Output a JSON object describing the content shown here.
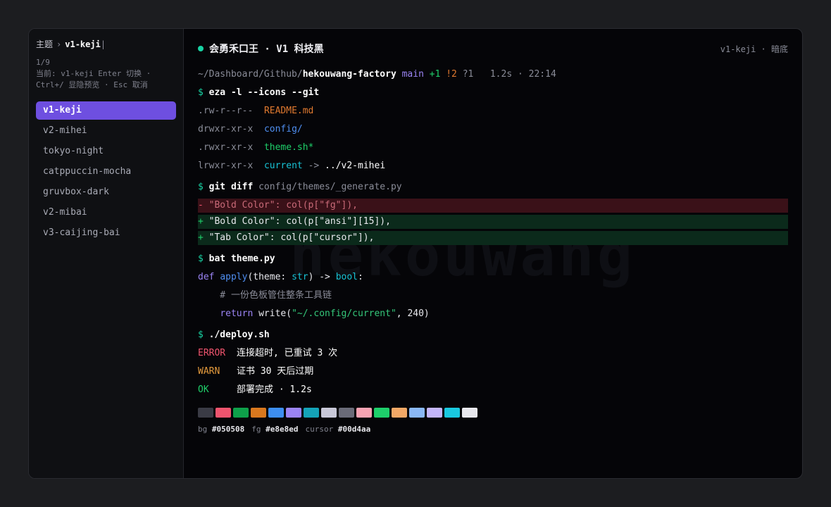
{
  "sidebar": {
    "breadcrumb_root": "主题",
    "breadcrumb_sep": "›",
    "breadcrumb_current": "v1-keji",
    "caret": "|",
    "counter": "1/9",
    "hint_line1": "当前: v1-keji  Enter 切换 ·",
    "hint_line2": "Ctrl+/ 显隐预览 · Esc 取消",
    "items": [
      {
        "label": "v1-keji",
        "active": true
      },
      {
        "label": "v2-mihei"
      },
      {
        "label": "tokyo-night"
      },
      {
        "label": "catppuccin-mocha"
      },
      {
        "label": "gruvbox-dark"
      },
      {
        "label": "v2-mibai"
      },
      {
        "label": "v3-caijing-bai"
      }
    ]
  },
  "header": {
    "title": "会勇禾口王 · V1 科技黑",
    "right": "v1-keji · 暗底"
  },
  "watermark": "hekouwang",
  "prompt_line": {
    "path": "~/Dashboard/Github/",
    "repo": "hekouwang-factory",
    "branch": "main",
    "added": "+1",
    "modified": "!2",
    "untracked": "?1",
    "timing": "1.2s · 22:14"
  },
  "cmd1": {
    "dollar": "$",
    "text": "eza -l --icons --git"
  },
  "files": [
    {
      "perm": ".rw-r--r--",
      "name": "README.md",
      "kind": "md"
    },
    {
      "perm": "drwxr-xr-x",
      "name": "config/",
      "kind": "dir"
    },
    {
      "perm": ".rwxr-xr-x",
      "name": "theme.sh*",
      "kind": "exec"
    },
    {
      "perm": "lrwxr-xr-x",
      "name": "current",
      "arrow": "->",
      "target": "../v2-mihei",
      "kind": "link"
    }
  ],
  "cmd2": {
    "dollar": "$",
    "text": "git diff",
    "arg": "config/themes/_generate.py"
  },
  "diff": {
    "del_mark": "-",
    "del_text": "\"Bold Color\": col(p[\"fg\"]),",
    "add1_mark": "+",
    "add1_text": "\"Bold Color\": col(p[\"ansi\"][15]),",
    "add2_mark": "+",
    "add2_text": "\"Tab Color\": col(p[\"cursor\"]),"
  },
  "cmd3": {
    "dollar": "$",
    "text": "bat theme.py"
  },
  "code": {
    "def": "def",
    "fn": "apply",
    "open": "(theme: ",
    "type": "str",
    "mid": ") -> ",
    "ret_type": "bool",
    "colon": ":",
    "comment": "    # 一份色板管住整条工具链",
    "return_kw": "return",
    "write_call": " write(",
    "write_str": "\"~/.config/current\"",
    "write_rest": ", 240)"
  },
  "cmd4": {
    "dollar": "$",
    "text": "./deploy.sh"
  },
  "logs": [
    {
      "level": "ERROR",
      "msg": "连接超时, 已重试 3 次"
    },
    {
      "level": "WARN",
      "msg": "证书 30 天后过期"
    },
    {
      "level": "OK",
      "msg": "部署完成 · 1.2s"
    }
  ],
  "palette": [
    "#3a3b45",
    "#f0546e",
    "#0ea04a",
    "#d9781e",
    "#3d8ef0",
    "#9b84f4",
    "#14a3b8",
    "#c8c8d8",
    "#6a6b78",
    "#f7a3b3",
    "#1ecf6a",
    "#f2a866",
    "#8ab8f5",
    "#c4b6fa",
    "#19c9e0",
    "#e8e8ed"
  ],
  "colors": {
    "bg_label": "bg",
    "bg": "#050508",
    "fg_label": "fg",
    "fg": "#e8e8ed",
    "cursor_label": "cursor",
    "cursor": "#00d4aa"
  }
}
